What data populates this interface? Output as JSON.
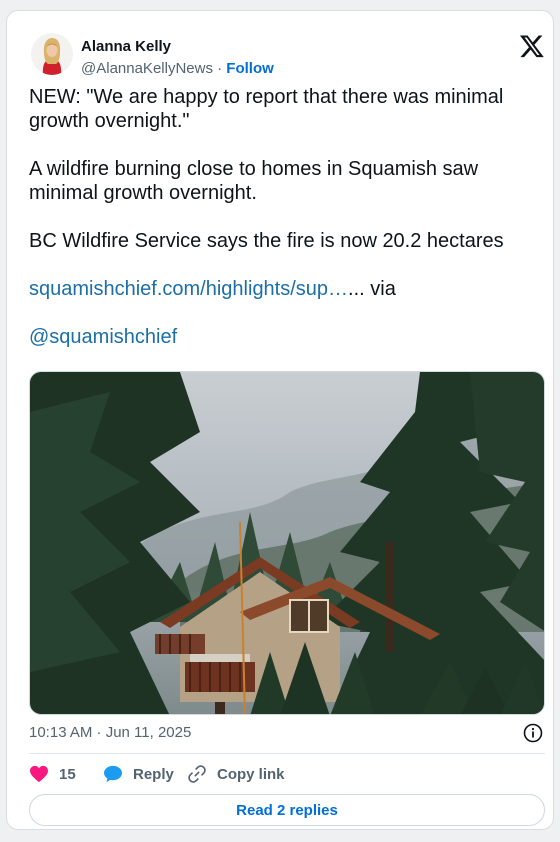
{
  "author": {
    "name": "Alanna Kelly",
    "handle": "@AlannaKellyNews",
    "separator": " · ",
    "follow_label": "Follow"
  },
  "tweet": {
    "line1": "NEW: \"We are happy to report that there was minimal growth overnight.\"",
    "line2": "A wildfire burning close to homes in Squamish saw minimal growth overnight.",
    "line3": "BC Wildfire Service says the fire is now 20.2 hectares",
    "link_text": "squamishchief.com/highlights/sup…",
    "link_suffix": "... via",
    "mention": "@squamishchief"
  },
  "timestamp": "10:13 AM · Jun 11, 2025",
  "actions": {
    "like_count": "15",
    "reply_label": "Reply",
    "copy_label": "Copy link"
  },
  "read_replies_label": "Read 2 replies",
  "icons": {
    "logo": "x-logo-icon",
    "like": "heart-icon",
    "reply": "speech-bubble-icon",
    "copy": "link-icon",
    "info": "info-icon"
  },
  "colors": {
    "link": "#1b6ea8",
    "follow": "#006fd6",
    "heart": "#f91880",
    "reply_bubble": "#1d9bf0",
    "muted": "#536471"
  }
}
